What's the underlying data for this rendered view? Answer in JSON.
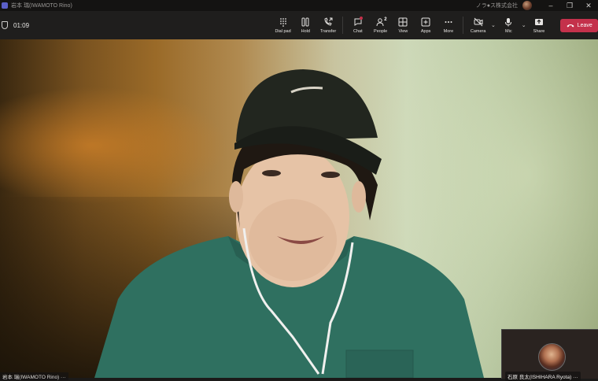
{
  "window": {
    "title": "岩本 瑞(IWAMOTO Rino)",
    "org": "ノラ●ス株式会社",
    "controls": [
      "–",
      "❐",
      "✕"
    ]
  },
  "toolbar": {
    "timer": "01:09",
    "buttons": [
      {
        "label": "Dial pad",
        "icon": "dialpad-icon"
      },
      {
        "label": "Hold",
        "icon": "pause-icon"
      },
      {
        "label": "Transfer",
        "icon": "phone-transfer-icon"
      },
      {
        "label": "Chat",
        "icon": "chat-icon"
      },
      {
        "label": "People",
        "icon": "people-icon",
        "count": "2"
      },
      {
        "label": "View",
        "icon": "grid-view-icon"
      },
      {
        "label": "Apps",
        "icon": "apps-add-icon"
      },
      {
        "label": "More",
        "icon": "more-ellipsis-icon"
      },
      {
        "label": "Camera",
        "icon": "camera-icon"
      },
      {
        "label": "Mic",
        "icon": "mic-icon"
      },
      {
        "label": "Share",
        "icon": "share-icon"
      }
    ],
    "leave_label": "Leave",
    "leave_color": "#c4314b"
  },
  "participants": {
    "main_name": "岩本 瑞(IWAMOTO Rino) ···",
    "self_name": "石原 良太(ISHIHARA Ryota) ···"
  }
}
